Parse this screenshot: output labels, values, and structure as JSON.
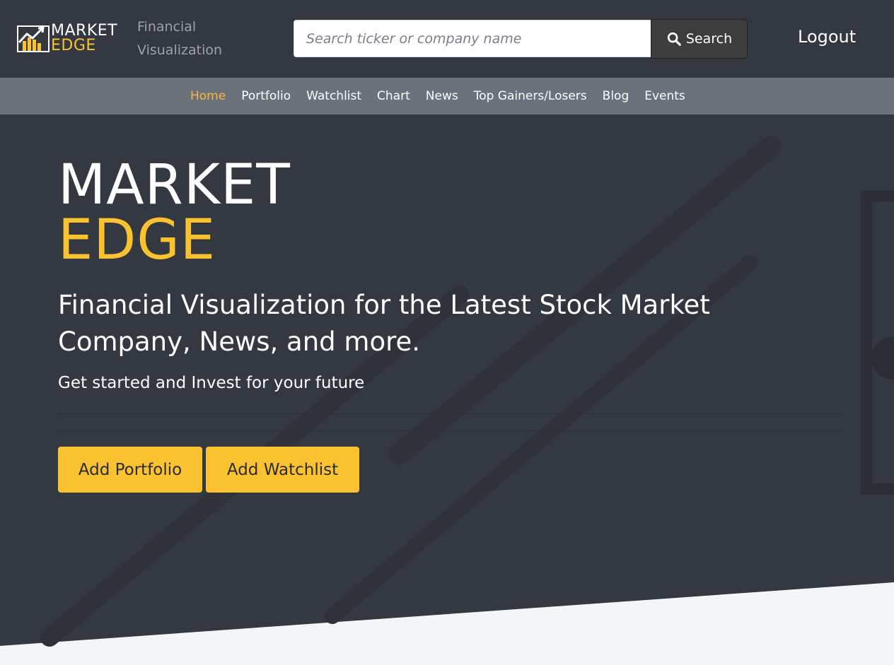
{
  "brand": {
    "logo_line1": "MARKET",
    "logo_line2": "EDGE",
    "tagline": "Financial Visualization",
    "accent_color": "#f9c22e",
    "dark_color": "#343840",
    "nav_color": "#6c727b"
  },
  "search": {
    "placeholder": "Search ticker or company name",
    "value": "",
    "button_label": "Search",
    "button_icon": "search-icon"
  },
  "header": {
    "logout_label": "Logout"
  },
  "nav": {
    "items": [
      {
        "label": "Home",
        "active": true
      },
      {
        "label": "Portfolio",
        "active": false
      },
      {
        "label": "Watchlist",
        "active": false
      },
      {
        "label": "Chart",
        "active": false
      },
      {
        "label": "News",
        "active": false
      },
      {
        "label": "Top Gainers/Losers",
        "active": false
      },
      {
        "label": "Blog",
        "active": false
      },
      {
        "label": "Events",
        "active": false
      }
    ]
  },
  "hero": {
    "title_line1": "MARKET",
    "title_line2": "EDGE",
    "lead": "Financial Visualization for the Latest Stock Market Company, News, and more.",
    "subtitle": "Get started and Invest for your future",
    "buttons": {
      "add_portfolio": "Add Portfolio",
      "add_watchlist": "Add Watchlist"
    }
  }
}
